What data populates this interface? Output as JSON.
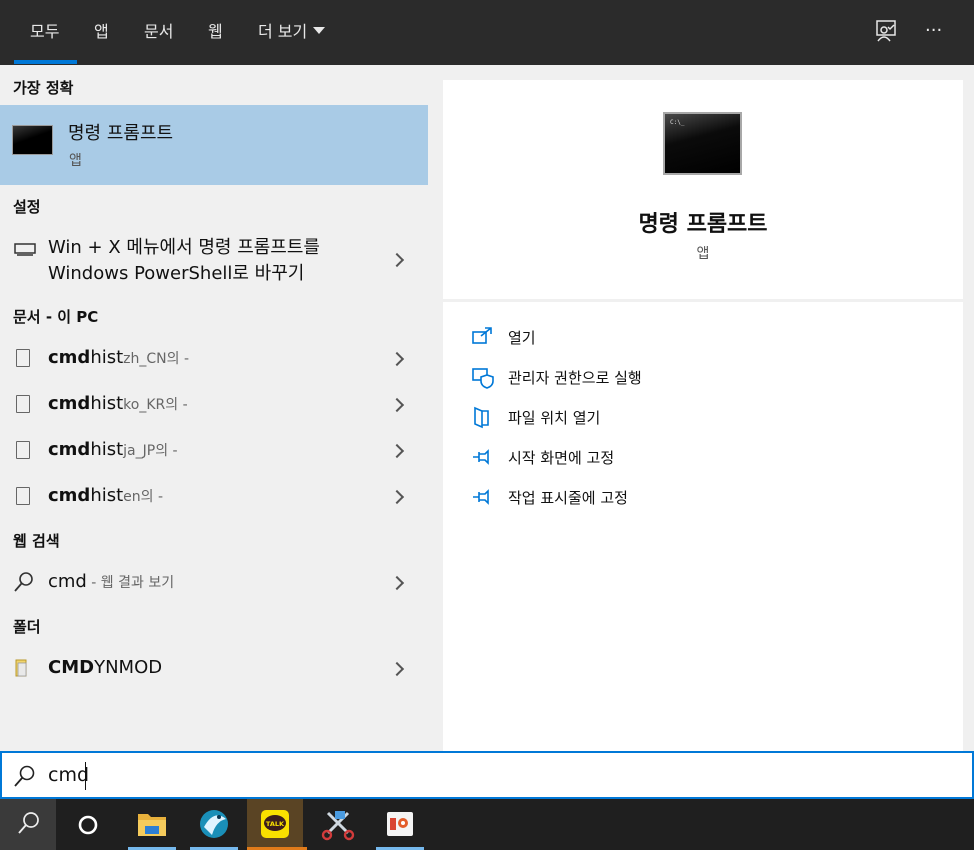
{
  "tabs": [
    {
      "label": "모두",
      "active": true
    },
    {
      "label": "앱"
    },
    {
      "label": "문서"
    },
    {
      "label": "웹"
    },
    {
      "label": "더 보기"
    }
  ],
  "top_icons": [
    "feedback-icon",
    "more-options-icon"
  ],
  "more_glyph": "···",
  "left": {
    "best_match_header": "가장 정확",
    "best_match": {
      "title": "명령 프롬프트",
      "subtitle": "앱",
      "icon": "command-prompt-icon"
    },
    "settings_header": "설정",
    "settings_item": {
      "line1": "Win + X 메뉴에서 명령 프롬프트를",
      "line2": "Windows PowerShell로 바꾸기",
      "icon": "display-settings-icon"
    },
    "documents_header": "문서 - 이 PC",
    "documents": [
      {
        "bold": "cmd",
        "rest": "hist",
        "suffix": "zh_CN의 -"
      },
      {
        "bold": "cmd",
        "rest": "hist",
        "suffix": "ko_KR의 -"
      },
      {
        "bold": "cmd",
        "rest": "hist",
        "suffix": "ja_JP의 -"
      },
      {
        "bold": "cmd",
        "rest": "hist",
        "suffix": "en의 -"
      }
    ],
    "web_header": "웹 검색",
    "web_item": {
      "text": "cmd",
      "suffix": " - 웹 결과 보기"
    },
    "folders_header": "폴더",
    "folder_item": {
      "bold": "CMD",
      "rest": "YNMOD"
    }
  },
  "right": {
    "app_title": "명령 프롬프트",
    "app_subtitle": "앱",
    "actions": [
      {
        "label": "열기",
        "icon": "open-icon"
      },
      {
        "label": "관리자 권한으로 실행",
        "icon": "admin-shield-icon"
      },
      {
        "label": "파일 위치 열기",
        "icon": "file-location-icon"
      },
      {
        "label": "시작 화면에 고정",
        "icon": "pin-icon"
      },
      {
        "label": "작업 표시줄에 고정",
        "icon": "pin-icon"
      }
    ]
  },
  "search": {
    "value": "cmd"
  },
  "taskbar": {
    "items": [
      "search-icon",
      "cortana-icon",
      "file-explorer-icon",
      "app-icon",
      "kakaotalk-icon",
      "snipping-tool-icon",
      "photos-app-icon"
    ],
    "kakao_label": "TALK"
  },
  "colors": {
    "accent": "#0078d7",
    "selected": "#a9cbe6",
    "topbar": "#2b2b2b",
    "taskbar": "#1f1f1f"
  }
}
